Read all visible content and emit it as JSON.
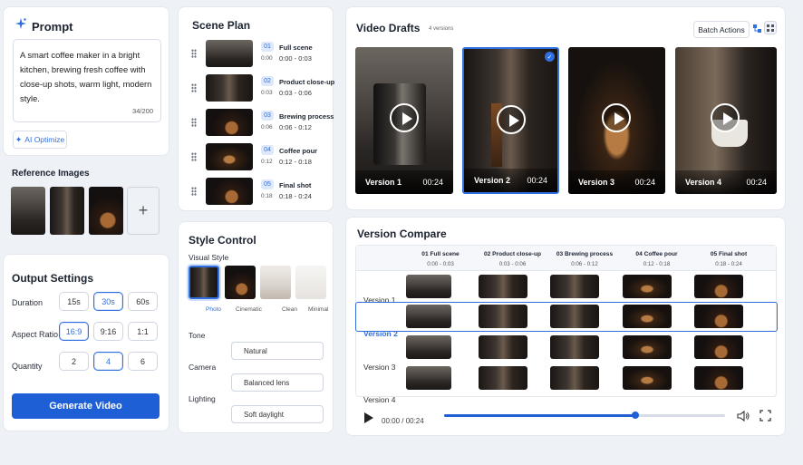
{
  "prompt": {
    "title": "Prompt",
    "text": "A smart coffee maker in a bright kitchen, brewing fresh coffee with close-up shots, warm light, modern style.",
    "counter": "34/200",
    "ai_optimize": "AI Optimize"
  },
  "reference": {
    "title": "Reference Images",
    "add": "+"
  },
  "output": {
    "title": "Output Settings",
    "duration_label": "Duration",
    "durations": [
      "15s",
      "30s",
      "60s"
    ],
    "duration_selected": "30s",
    "aspect_label": "Aspect Ratio",
    "aspects": [
      "16:9",
      "9:16",
      "1:1"
    ],
    "aspect_selected": "16:9",
    "quantity_label": "Quantity",
    "quantities": [
      "2",
      "4",
      "6"
    ],
    "quantity_selected": "4",
    "generate": "Generate Video"
  },
  "scene_plan": {
    "title": "Scene Plan",
    "scenes": [
      {
        "num": "01",
        "name": "Full scene",
        "range": "0:00 - 0:03",
        "start": "0:00"
      },
      {
        "num": "02",
        "name": "Product close-up",
        "range": "0:03 - 0:06",
        "start": "0:03"
      },
      {
        "num": "03",
        "name": "Brewing process",
        "range": "0:06 - 0:12",
        "start": "0:06"
      },
      {
        "num": "04",
        "name": "Coffee pour",
        "range": "0:12 - 0:18",
        "start": "0:12"
      },
      {
        "num": "05",
        "name": "Final shot",
        "range": "0:18 - 0:24",
        "start": "0:18"
      }
    ]
  },
  "style": {
    "title": "Style Control",
    "visual_label": "Visual Style",
    "styles": [
      "Photo",
      "Cinematic",
      "Clean",
      "Minimal"
    ],
    "style_selected": "Photo",
    "tone_label": "Tone",
    "tone": "Natural",
    "camera_label": "Camera",
    "camera": "Balanced lens",
    "lighting_label": "Lighting",
    "lighting": "Soft daylight"
  },
  "drafts": {
    "title": "Video Drafts",
    "count": "4 versions",
    "batch": "Batch Actions",
    "versions": [
      {
        "name": "Version 1",
        "duration": "00:24"
      },
      {
        "name": "Version 2",
        "duration": "00:24"
      },
      {
        "name": "Version 3",
        "duration": "00:24"
      },
      {
        "name": "Version 4",
        "duration": "00:24"
      }
    ],
    "selected": "Version 2"
  },
  "compare": {
    "title": "Version Compare",
    "columns": [
      {
        "name": "01 Full scene",
        "range": "0:00 - 0:03"
      },
      {
        "name": "02 Product close-up",
        "range": "0:03 - 0:06"
      },
      {
        "name": "03 Brewing process",
        "range": "0:06 - 0:12"
      },
      {
        "name": "04 Coffee pour",
        "range": "0:12 - 0:18"
      },
      {
        "name": "05 Final shot",
        "range": "0:18 - 0:24"
      }
    ],
    "rows": [
      "Version 1",
      "Version 2",
      "Version 3",
      "Version 4"
    ],
    "selected_row": "Version 2",
    "time": "00:00 / 00:24",
    "progress": 0.68
  },
  "colors": {
    "accent": "#2f6fe0",
    "primary_button": "#1f5fd6"
  }
}
